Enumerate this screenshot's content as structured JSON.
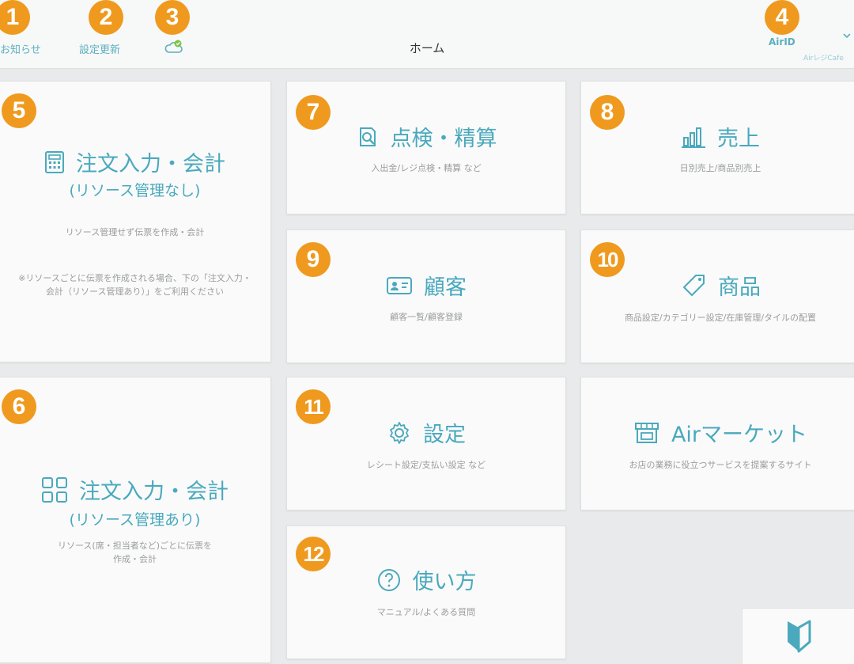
{
  "header": {
    "notifications_label": "お知らせ",
    "settings_update_label": "設定更新",
    "page_title": "ホーム",
    "airid_label": "AirID",
    "airid_sub": "AirレジCafe",
    "sync_icon": "cloud-sync-icon"
  },
  "badges": [
    "1",
    "2",
    "3",
    "4",
    "5",
    "6",
    "7",
    "8",
    "9",
    "10",
    "11",
    "12"
  ],
  "cards": {
    "order_no_resource": {
      "title": "注文入力・会計",
      "subtitle": "(リソース管理なし)",
      "desc": "リソース管理せず伝票を作成・会計",
      "note": "※リソースごとに伝票を作成される場合、下の「注文入力・会計（リソース管理あり）」をご利用ください",
      "icon": "calculator-icon"
    },
    "order_with_resource": {
      "title": "注文入力・会計",
      "subtitle": "(リソース管理あり)",
      "desc": "リソース(席・担当者など)ごとに伝票を作成・会計",
      "icon": "grid-icon"
    },
    "inspection": {
      "title": "点検・精算",
      "desc": "入出金/レジ点検・精算 など",
      "icon": "inspection-icon"
    },
    "sales": {
      "title": "売上",
      "desc": "日別売上/商品別売上",
      "icon": "bar-chart-icon"
    },
    "customers": {
      "title": "顧客",
      "desc": "顧客一覧/顧客登録",
      "icon": "customer-card-icon"
    },
    "products": {
      "title": "商品",
      "desc": "商品設定/カテゴリー設定/在庫管理/タイルの配置",
      "icon": "tag-icon"
    },
    "settings": {
      "title": "設定",
      "desc": "レシート設定/支払い設定 など",
      "icon": "gear-icon"
    },
    "air_market": {
      "title": "Airマーケット",
      "desc": "お店の業務に役立つサービスを提案するサイト",
      "icon": "storefront-icon"
    },
    "howto": {
      "title": "使い方",
      "desc": "マニュアル/よくある質問",
      "icon": "question-icon"
    }
  },
  "colors": {
    "accent": "#4aa9bd",
    "badge": "#ef9a1e",
    "background": "#e9eaeb"
  }
}
